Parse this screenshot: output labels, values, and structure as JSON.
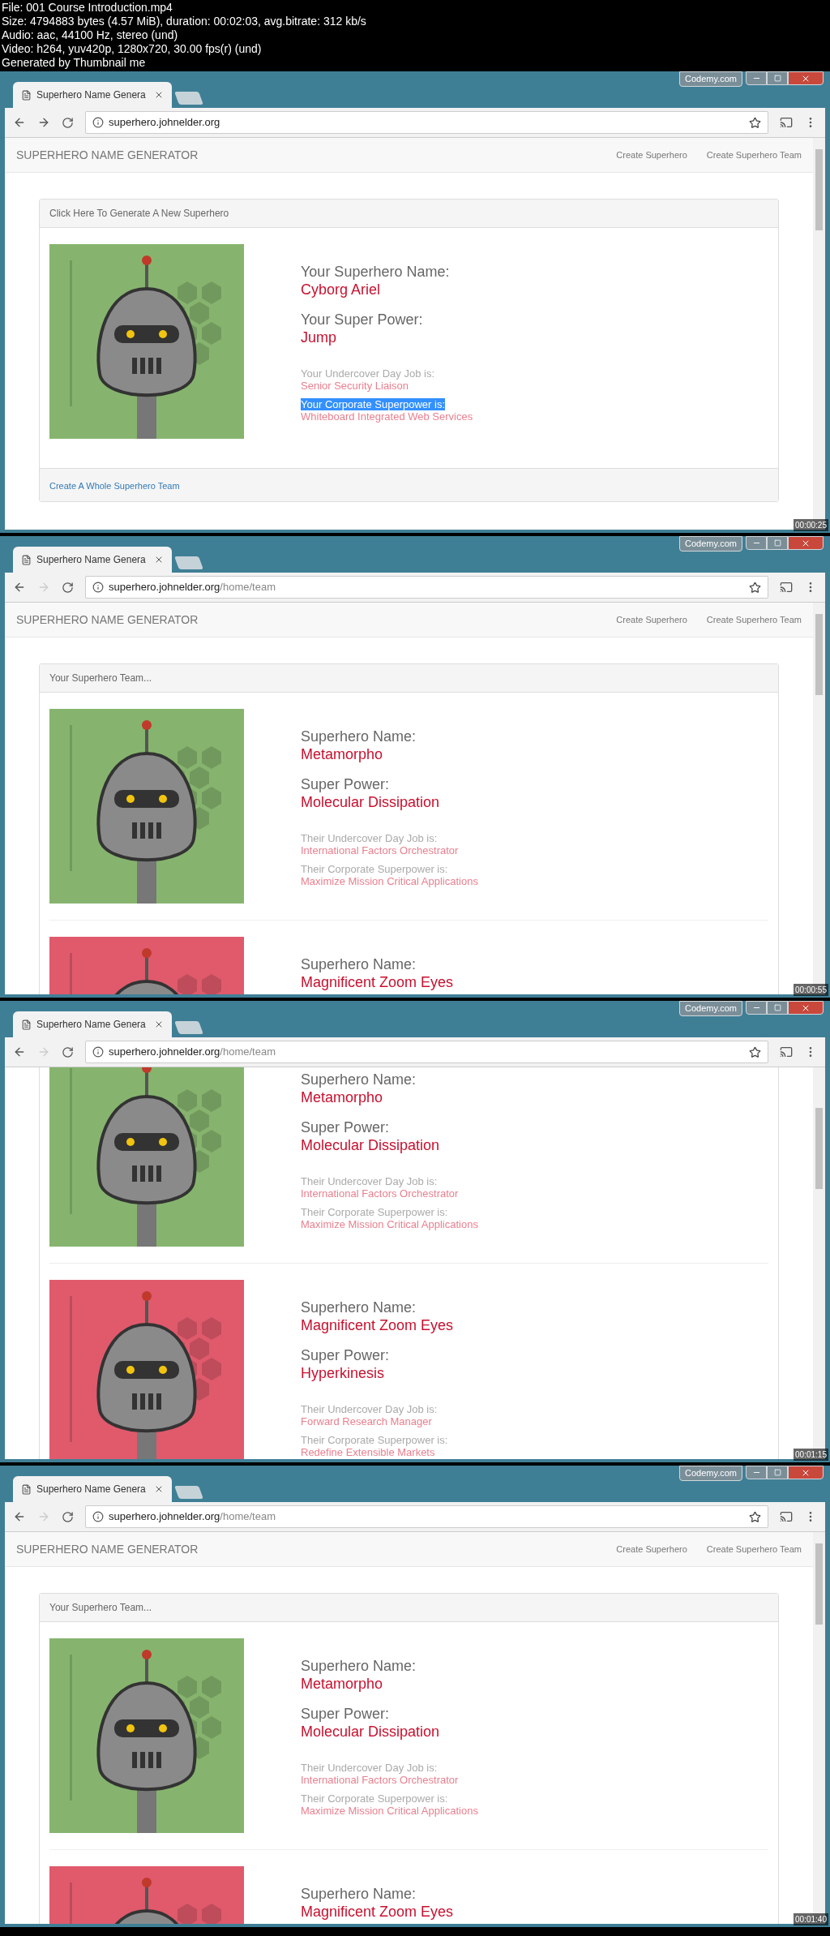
{
  "file_info": [
    "File: 001 Course Introduction.mp4",
    "Size: 4794883 bytes (4.57 MiB), duration: 00:02:03, avg.bitrate: 312 kb/s",
    "Audio: aac, 44100 Hz, stereo (und)",
    "Video: h264, yuv420p, 1280x720, 30.00 fps(r) (und)",
    "Generated by Thumbnail me"
  ],
  "frames": [
    {
      "timestamp": "00:00:25",
      "tab_title": "Superhero Name Genera",
      "window_badge": "Codemy.com",
      "url_host": "superhero.johnelder.org",
      "forward_enabled": true,
      "scrolled": false,
      "navbar": {
        "brand": "SUPERHERO NAME GENERATOR",
        "links": [
          "Create Superhero",
          "Create Superhero Team"
        ]
      },
      "panel_heading": "Click Here To Generate A New Superhero",
      "heroes": [
        {
          "color": "#86b46e",
          "fields": [
            {
              "kind": "name",
              "label": "Your Superhero Name:",
              "value": "Cyborg Ariel",
              "highlighted": false
            },
            {
              "kind": "name",
              "label": "Your Super Power:",
              "value": "Jump",
              "highlighted": false
            },
            {
              "kind": "detail",
              "label": "Your Undercover Day Job is:",
              "value": "Senior Security Liaison",
              "highlighted": false
            },
            {
              "kind": "detail",
              "label": "Your Corporate Superpower is:",
              "value": "Whiteboard Integrated Web Services",
              "highlighted": true
            }
          ]
        }
      ],
      "footer_link": "Create A Whole Superhero Team"
    },
    {
      "timestamp": "00:00:55",
      "tab_title": "Superhero Name Genera",
      "window_badge": "Codemy.com",
      "url_host": "superhero.johnelder.org",
      "url_path": "/home/team",
      "forward_enabled": false,
      "scrolled": false,
      "navbar": {
        "brand": "SUPERHERO NAME GENERATOR",
        "links": [
          "Create Superhero",
          "Create Superhero Team"
        ]
      },
      "panel_heading": "Your Superhero Team...",
      "heroes": [
        {
          "color": "#86b46e",
          "fields": [
            {
              "kind": "name",
              "label": "Superhero Name:",
              "value": "Metamorpho",
              "highlighted": false
            },
            {
              "kind": "name",
              "label": "Super Power:",
              "value": "Molecular Dissipation",
              "highlighted": false
            },
            {
              "kind": "detail",
              "label": "Their Undercover Day Job is:",
              "value": "International Factors Orchestrator",
              "highlighted": false
            },
            {
              "kind": "detail",
              "label": "Their Corporate Superpower is:",
              "value": "Maximize Mission Critical Applications",
              "highlighted": false
            }
          ]
        },
        {
          "color": "#e05a6c",
          "fields": [
            {
              "kind": "name",
              "label": "Superhero Name:",
              "value": "Magnificent Zoom Eyes",
              "highlighted": false
            }
          ]
        }
      ]
    },
    {
      "timestamp": "00:01:15",
      "tab_title": "Superhero Name Genera",
      "window_badge": "Codemy.com",
      "url_host": "superhero.johnelder.org",
      "url_path": "/home/team",
      "forward_enabled": false,
      "scrolled": true,
      "heroes": [
        {
          "color": "#86b46e",
          "fields": [
            {
              "kind": "name",
              "label": "Superhero Name:",
              "value": "Metamorpho",
              "highlighted": false
            },
            {
              "kind": "name",
              "label": "Super Power:",
              "value": "Molecular Dissipation",
              "highlighted": false
            },
            {
              "kind": "detail",
              "label": "Their Undercover Day Job is:",
              "value": "International Factors Orchestrator",
              "highlighted": false
            },
            {
              "kind": "detail",
              "label": "Their Corporate Superpower is:",
              "value": "Maximize Mission Critical Applications",
              "highlighted": false
            }
          ]
        },
        {
          "color": "#e05a6c",
          "fields": [
            {
              "kind": "name",
              "label": "Superhero Name:",
              "value": "Magnificent Zoom Eyes",
              "highlighted": false
            },
            {
              "kind": "name",
              "label": "Super Power:",
              "value": "Hyperkinesis",
              "highlighted": false
            },
            {
              "kind": "detail",
              "label": "Their Undercover Day Job is:",
              "value": "Forward Research Manager",
              "highlighted": false
            },
            {
              "kind": "detail",
              "label": "Their Corporate Superpower is:",
              "value": "Redefine Extensible Markets",
              "highlighted": false
            }
          ]
        }
      ]
    },
    {
      "timestamp": "00:01:40",
      "tab_title": "Superhero Name Genera",
      "window_badge": "Codemy.com",
      "url_host": "superhero.johnelder.org",
      "url_path": "/home/team",
      "forward_enabled": false,
      "scrolled": false,
      "navbar": {
        "brand": "SUPERHERO NAME GENERATOR",
        "links": [
          "Create Superhero",
          "Create Superhero Team"
        ]
      },
      "panel_heading": "Your Superhero Team...",
      "heroes": [
        {
          "color": "#86b46e",
          "fields": [
            {
              "kind": "name",
              "label": "Superhero Name:",
              "value": "Metamorpho",
              "highlighted": false
            },
            {
              "kind": "name",
              "label": "Super Power:",
              "value": "Molecular Dissipation",
              "highlighted": false
            },
            {
              "kind": "detail",
              "label": "Their Undercover Day Job is:",
              "value": "International Factors Orchestrator",
              "highlighted": false
            },
            {
              "kind": "detail",
              "label": "Their Corporate Superpower is:",
              "value": "Maximize Mission Critical Applications",
              "highlighted": false
            }
          ]
        },
        {
          "color": "#e05a6c",
          "fields": [
            {
              "kind": "name",
              "label": "Superhero Name:",
              "value": "Magnificent Zoom Eyes",
              "highlighted": false
            }
          ]
        }
      ]
    }
  ]
}
